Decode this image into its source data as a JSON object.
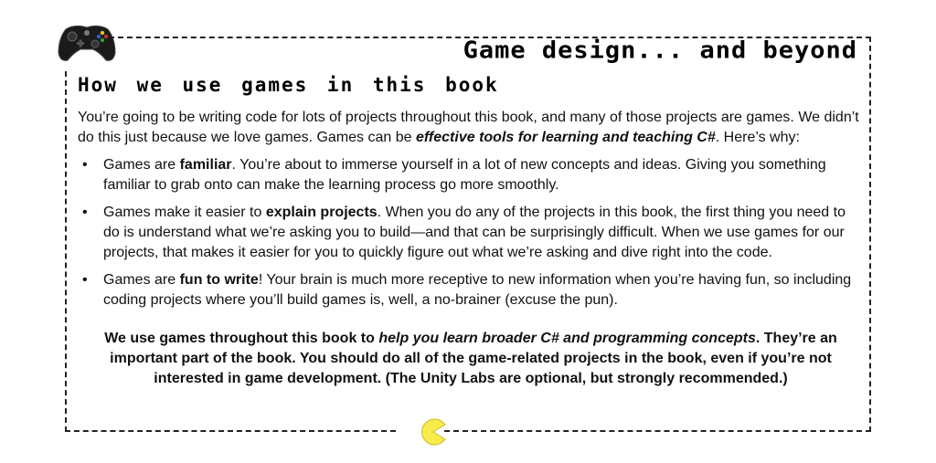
{
  "header": {
    "title": "Game design... and beyond",
    "subtitle": "How we use games in this book"
  },
  "icons": {
    "top_left": "game-controller-icon",
    "bottom_center": "pacman-icon"
  },
  "colors": {
    "pacman_fill": "#f7ec4a",
    "pacman_stroke": "#c9b92a",
    "controller_body": "#1b1b1b",
    "border": "#222222"
  },
  "intro": {
    "part1": "You’re going to be writing code for lots of projects throughout this book, and many of those projects are games. We didn’t do this just because we love games. Games can be ",
    "emphasis": "effective tools for learning and teaching C#",
    "part2": ". Here’s why:"
  },
  "bullets": [
    {
      "bullet": "•",
      "before": "Games are ",
      "bold": "familiar",
      "after": ". You’re about to immerse yourself in a lot of new concepts and ideas. Giving you something familiar to grab onto can make the learning process go more smoothly."
    },
    {
      "bullet": "•",
      "before": "Games make it easier to ",
      "bold": "explain projects",
      "after": ". When you do any of the projects in this book, the first thing you need to do is understand what we’re asking you to build—and that can be surprisingly difficult. When we use games for our projects, that makes it easier for you to quickly figure out what we’re asking and dive right into the code."
    },
    {
      "bullet": "•",
      "before": "Games are ",
      "bold": "fun to write",
      "after": "! Your brain is much more receptive to new information when you’re having fun, so including coding projects where you’ll build games is, well, a no-brainer (excuse the pun)."
    }
  ],
  "summary": {
    "part1": "We use games throughout this book to ",
    "italic": "help you learn broader C# and programming concepts",
    "part2": ". They’re an important part of the book. You should do all of the game-related projects in the book, even if you’re not interested in game development. (The Unity Labs are optional, but strongly recommended.)"
  }
}
